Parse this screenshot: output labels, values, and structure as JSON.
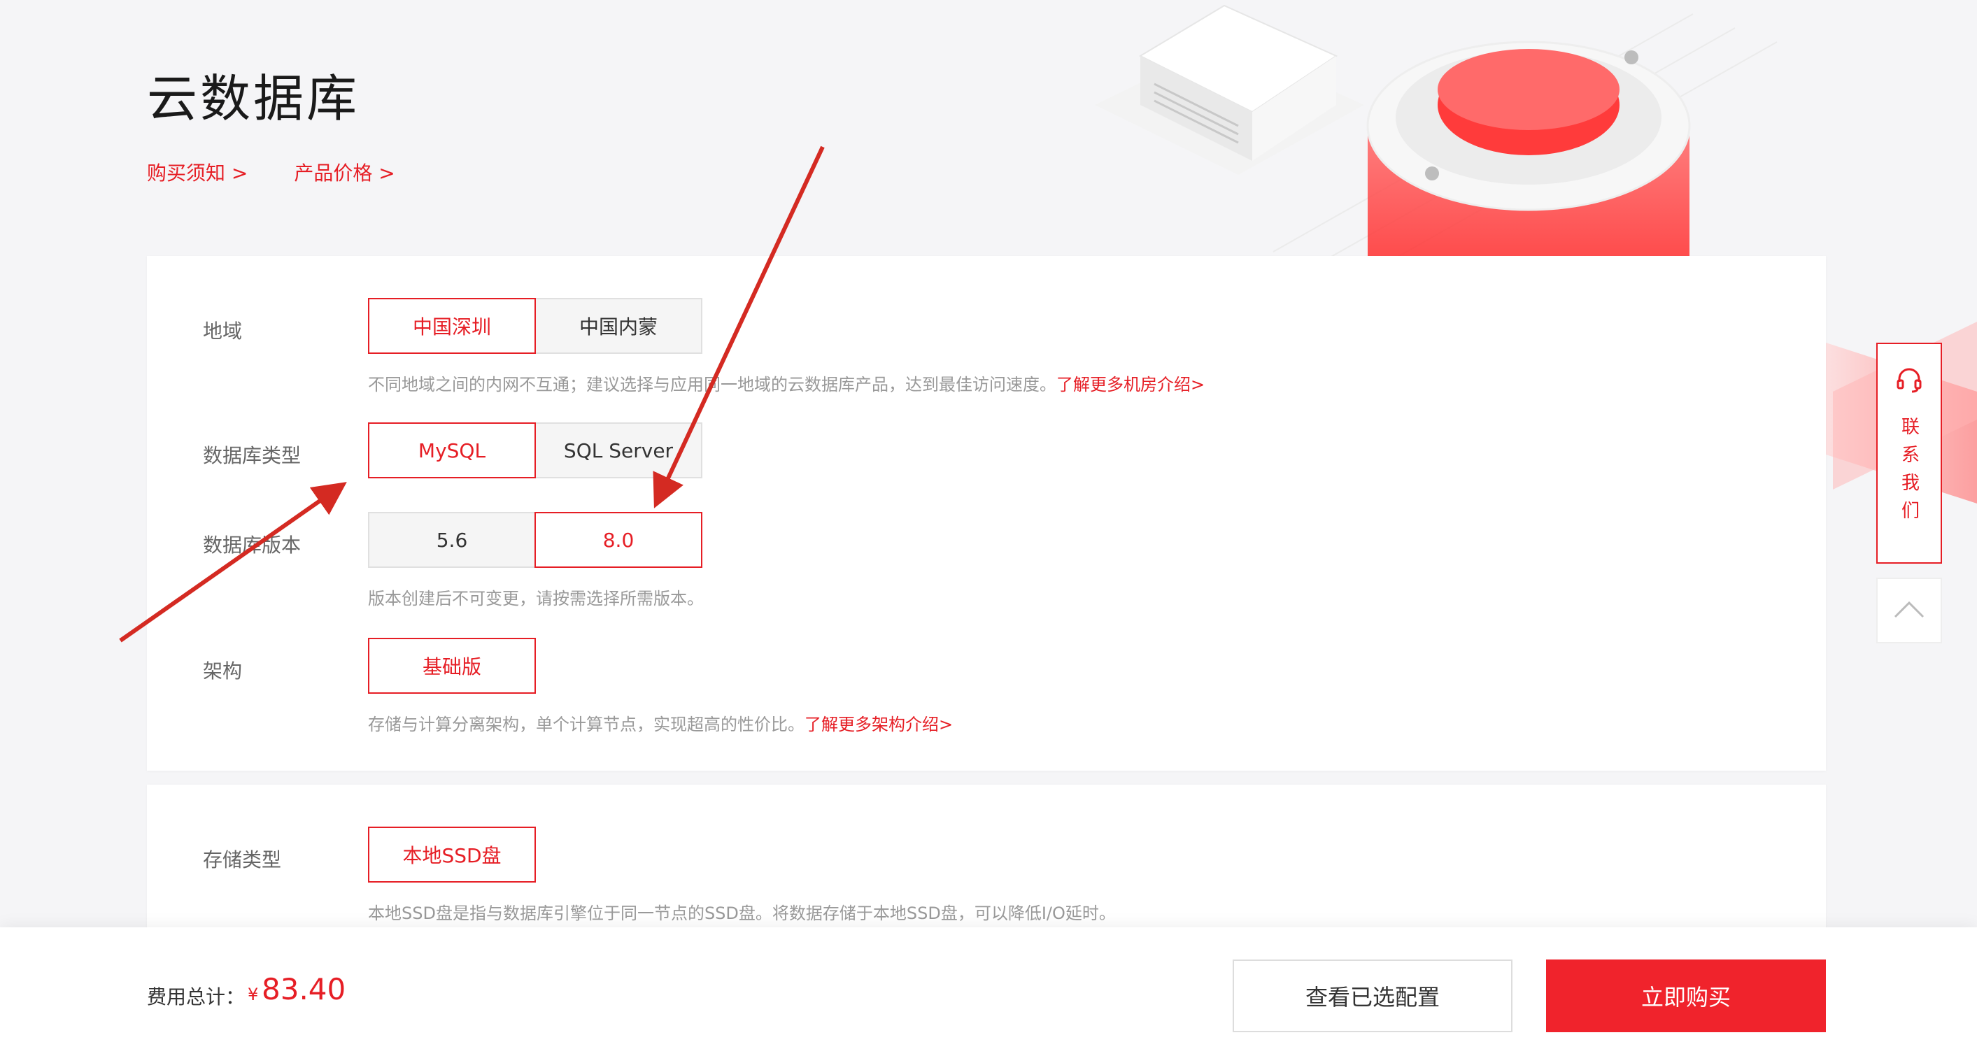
{
  "header": {
    "title": "云数据库",
    "links": [
      "购买须知 >",
      "产品价格 >"
    ]
  },
  "config": {
    "region": {
      "label": "地域",
      "options": [
        "中国深圳",
        "中国内蒙"
      ],
      "selected": "中国深圳",
      "hint": "不同地域之间的内网不互通；建议选择与应用同一地域的云数据库产品，达到最佳访问速度。",
      "hint_link": "了解更多机房介绍>"
    },
    "db_type": {
      "label": "数据库类型",
      "options": [
        "MySQL",
        "SQL Server"
      ],
      "selected": "MySQL"
    },
    "db_version": {
      "label": "数据库版本",
      "options": [
        "5.6",
        "8.0"
      ],
      "selected": "8.0",
      "hint": "版本创建后不可变更，请按需选择所需版本。"
    },
    "architecture": {
      "label": "架构",
      "options": [
        "基础版"
      ],
      "selected": "基础版",
      "hint": "存储与计算分离架构，单个计算节点，实现超高的性价比。",
      "hint_link": "了解更多架构介绍>"
    },
    "storage": {
      "label": "存储类型",
      "options": [
        "本地SSD盘"
      ],
      "selected": "本地SSD盘",
      "hint": "本地SSD盘是指与数据库引擎位于同一节点的SSD盘。将数据存储于本地SSD盘，可以降低I/O延时。"
    }
  },
  "footer": {
    "total_label": "费用总计：",
    "currency": "¥",
    "total_value": "83.40",
    "view_button": "查看已选配置",
    "buy_button": "立即购买"
  },
  "side": {
    "contact_label": "联系我们"
  },
  "colors": {
    "accent": "#e61e25",
    "annotation_arrow": "#d42a22"
  }
}
